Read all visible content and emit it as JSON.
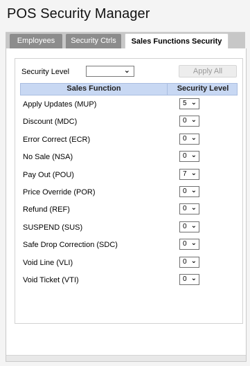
{
  "app": {
    "title": "POS Security Manager"
  },
  "tabs": [
    {
      "label": "Employees"
    },
    {
      "label": "Security Ctrls"
    },
    {
      "label": "Sales Functions Security"
    }
  ],
  "filter": {
    "security_level_label": "Security Level",
    "security_level_value": "",
    "apply_all_label": "Apply All"
  },
  "grid": {
    "columns": [
      "Sales Function",
      "Security Level"
    ],
    "rows": [
      {
        "function": "Apply Updates (MUP)",
        "level": "5"
      },
      {
        "function": "Discount (MDC)",
        "level": "0"
      },
      {
        "function": "Error Correct (ECR)",
        "level": "0"
      },
      {
        "function": "No Sale (NSA)",
        "level": "0"
      },
      {
        "function": "Pay Out (POU)",
        "level": "7"
      },
      {
        "function": "Price Override (POR)",
        "level": "0"
      },
      {
        "function": "Refund (REF)",
        "level": "0"
      },
      {
        "function": "SUSPEND (SUS)",
        "level": "0"
      },
      {
        "function": "Safe Drop Correction (SDC)",
        "level": "0"
      },
      {
        "function": "Void Line (VLI)",
        "level": "0"
      },
      {
        "function": "Void Ticket (VTI)",
        "level": "0"
      }
    ]
  },
  "icons": {
    "dropdown": "chevron-down-icon"
  },
  "colors": {
    "header_bg": "#c8d8f3",
    "tab_inactive": "#8c8c8c",
    "tab_bar": "#c7c7c7"
  }
}
